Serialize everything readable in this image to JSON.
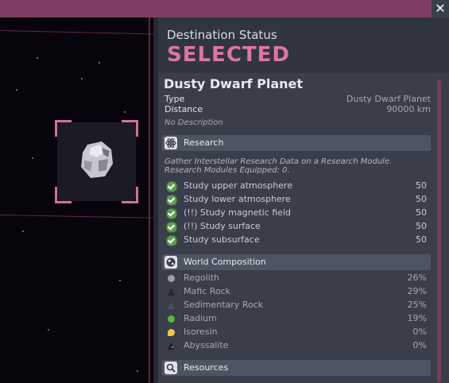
{
  "window": {
    "close_label": "✕"
  },
  "destination": {
    "header": "Destination Status",
    "status": "SELECTED",
    "name": "Dusty Dwarf Planet",
    "properties": [
      {
        "label": "Type",
        "value": "Dusty Dwarf Planet"
      },
      {
        "label": "Distance",
        "value": "90000  km"
      }
    ],
    "description": "No Description"
  },
  "research": {
    "title": "Research",
    "icon": "atom-icon",
    "info": "Gather Interstellar Research Data on a Research Module. Research Modules Equipped: 0.",
    "tasks": [
      {
        "label": "Study upper atmosphere",
        "value": "50"
      },
      {
        "label": "Study lower atmosphere",
        "value": "50"
      },
      {
        "label": "(!!) Study magnetic field",
        "value": "50"
      },
      {
        "label": "(!!) Study surface",
        "value": "50"
      },
      {
        "label": "Study subsurface",
        "value": "50"
      }
    ]
  },
  "composition": {
    "title": "World Composition",
    "icon": "globe-icon",
    "items": [
      {
        "label": "Regolith",
        "value": "26%",
        "color": "#9aa0a6"
      },
      {
        "label": "Mafic Rock",
        "value": "29%",
        "color": "#3c3f57"
      },
      {
        "label": "Sedimentary Rock",
        "value": "25%",
        "color": "#50546e"
      },
      {
        "label": "Radium",
        "value": "19%",
        "color": "#58b93f"
      },
      {
        "label": "Isoresin",
        "value": "0%",
        "color": "#e9c93e"
      },
      {
        "label": "Abyssalite",
        "value": "0%",
        "color": "#2b2640"
      }
    ]
  },
  "resources": {
    "title": "Resources",
    "icon": "magnifier-icon"
  }
}
